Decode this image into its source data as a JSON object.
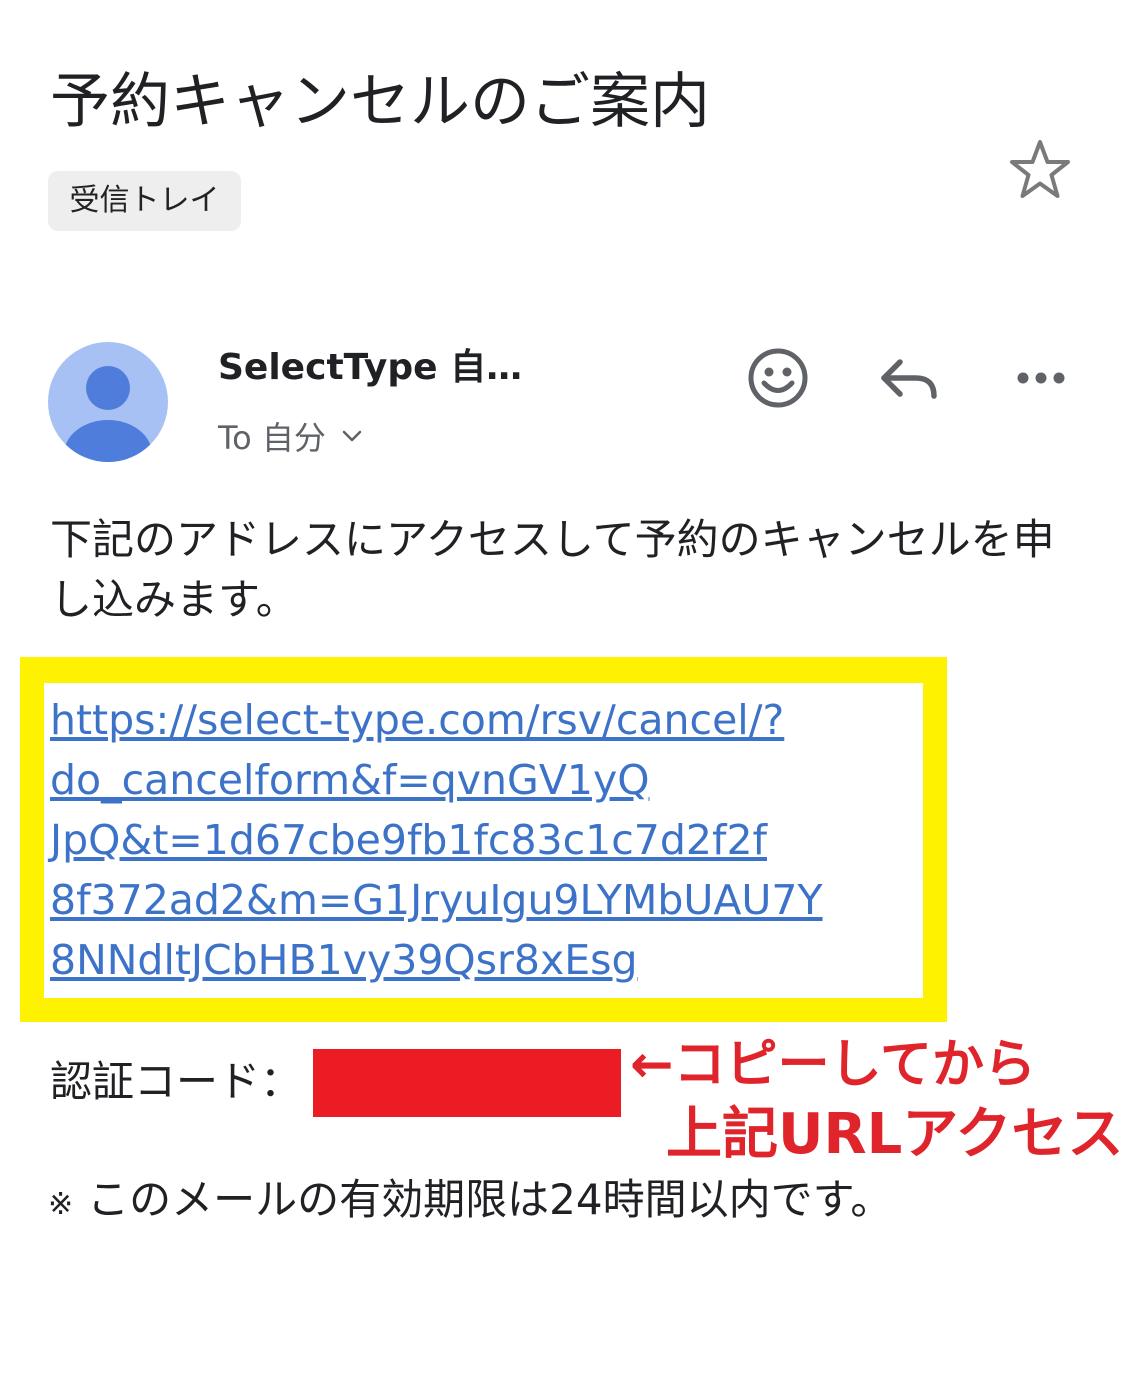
{
  "email": {
    "subject": "予約キャンセルのご案内",
    "label": "受信トレイ",
    "sender": "SelectType 自…",
    "recipient": "To 自分",
    "icons": {
      "star": "star-outline-icon",
      "avatar": "person-avatar-icon",
      "emoji": "emoji-reaction-icon",
      "reply": "reply-icon",
      "more": "more-options-icon",
      "recipient_toggle": "chevron-down-icon"
    }
  },
  "body": {
    "intro": "下記のアドレスにアクセスして予約のキャンセルを申し込みます。",
    "link_lines": [
      "https://select-type.com/rsv/cancel/?",
      "do_cancelform&f=qvnGV1yQ",
      "JpQ&t=1d67cbe9fb1fc83c1c7d2f2f",
      "8f372ad2&m=G1JryuIgu9LYMbUAU7Y",
      "8NNdltJCbHB1vy39Qsr8xEsg"
    ],
    "auth_label": "認証コード：",
    "expiry_mark": "※",
    "expiry": "このメールの有効期限は24時間以内です。"
  },
  "annotation": {
    "line1": "←コピーしてから",
    "line2": "上記URLアクセス"
  },
  "colors": {
    "link": "#3c72c7",
    "highlight": "#fff200",
    "redaction": "#ec1c24",
    "annotation": "#e0242b",
    "avatar_bg": "#a8c1f5",
    "avatar_figure": "#4f7ddc"
  }
}
